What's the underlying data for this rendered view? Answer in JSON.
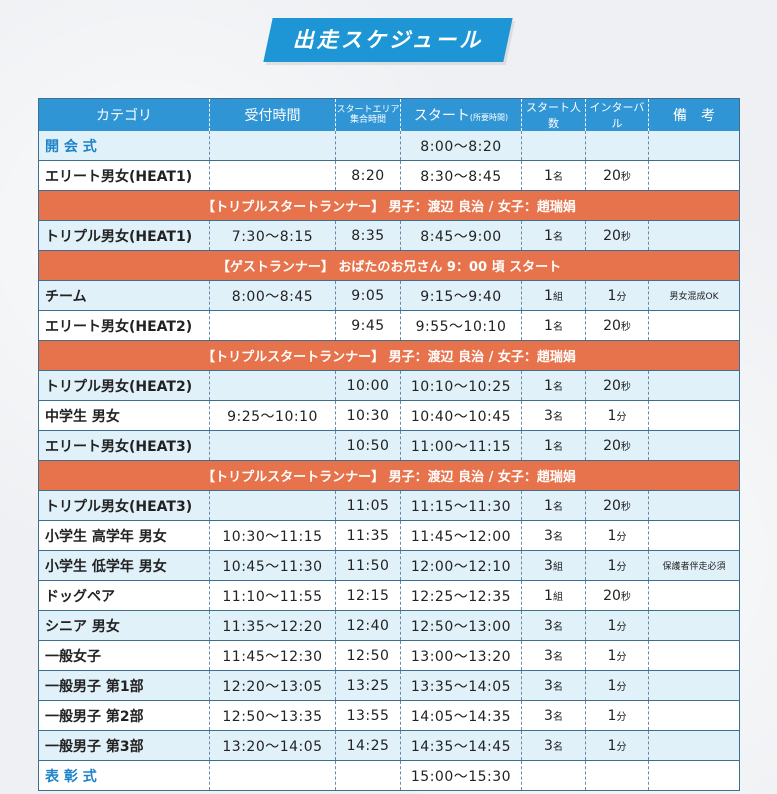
{
  "title": "出走スケジュール",
  "headers": {
    "category": "カテゴリ",
    "reception": "受付時間",
    "gather_line1": "スタートエリア",
    "gather_line2": "集合時間",
    "start": "スタート",
    "start_note": "(所要時間)",
    "count": "スタート人数",
    "interval": "インターバル",
    "remarks": "備　考"
  },
  "rows": [
    {
      "type": "row",
      "category": "開 会 式",
      "category_blue": true,
      "reception": "",
      "gather": "",
      "start": "8:00〜8:20",
      "count": "",
      "count_unit": "",
      "interval": "",
      "interval_unit": "",
      "note": ""
    },
    {
      "type": "row",
      "category": "エリート男女(HEAT1)",
      "reception": "",
      "gather": "8:20",
      "start": "8:30〜8:45",
      "count": "1",
      "count_unit": "名",
      "interval": "20",
      "interval_unit": "秒",
      "note": ""
    },
    {
      "type": "banner",
      "text": "【トリプルスタートランナー】 男子：渡辺 良治 / 女子：趙瑞娟"
    },
    {
      "type": "row",
      "category": "トリプル男女(HEAT1)",
      "reception": "7:30〜8:15",
      "gather": "8:35",
      "start": "8:45〜9:00",
      "count": "1",
      "count_unit": "名",
      "interval": "20",
      "interval_unit": "秒",
      "note": ""
    },
    {
      "type": "banner",
      "text": "【ゲストランナー】 おばたのお兄さん 9：00 頃 スタート"
    },
    {
      "type": "row",
      "category": "チーム",
      "reception": "8:00〜8:45",
      "gather": "9:05",
      "start": "9:15〜9:40",
      "count": "1",
      "count_unit": "組",
      "interval": "1",
      "interval_unit": "分",
      "note": "男女混成OK"
    },
    {
      "type": "row",
      "category": "エリート男女(HEAT2)",
      "reception": "",
      "gather": "9:45",
      "start": "9:55〜10:10",
      "count": "1",
      "count_unit": "名",
      "interval": "20",
      "interval_unit": "秒",
      "note": ""
    },
    {
      "type": "banner",
      "text": "【トリプルスタートランナー】 男子：渡辺 良治 / 女子：趙瑞娟"
    },
    {
      "type": "row",
      "category": "トリプル男女(HEAT2)",
      "reception": "",
      "gather": "10:00",
      "start": "10:10〜10:25",
      "count": "1",
      "count_unit": "名",
      "interval": "20",
      "interval_unit": "秒",
      "note": ""
    },
    {
      "type": "row",
      "category": "中学生 男女",
      "reception": "9:25〜10:10",
      "gather": "10:30",
      "start": "10:40〜10:45",
      "count": "3",
      "count_unit": "名",
      "interval": "1",
      "interval_unit": "分",
      "note": ""
    },
    {
      "type": "row",
      "category": "エリート男女(HEAT3)",
      "reception": "",
      "gather": "10:50",
      "start": "11:00〜11:15",
      "count": "1",
      "count_unit": "名",
      "interval": "20",
      "interval_unit": "秒",
      "note": ""
    },
    {
      "type": "banner",
      "text": "【トリプルスタートランナー】 男子：渡辺 良治 / 女子：趙瑞娟"
    },
    {
      "type": "row",
      "category": "トリプル男女(HEAT3)",
      "reception": "",
      "gather": "11:05",
      "start": "11:15〜11:30",
      "count": "1",
      "count_unit": "名",
      "interval": "20",
      "interval_unit": "秒",
      "note": ""
    },
    {
      "type": "row",
      "category": "小学生 高学年 男女",
      "reception": "10:30〜11:15",
      "gather": "11:35",
      "start": "11:45〜12:00",
      "count": "3",
      "count_unit": "名",
      "interval": "1",
      "interval_unit": "分",
      "note": ""
    },
    {
      "type": "row",
      "category": "小学生 低学年 男女",
      "reception": "10:45〜11:30",
      "gather": "11:50",
      "start": "12:00〜12:10",
      "count": "3",
      "count_unit": "組",
      "interval": "1",
      "interval_unit": "分",
      "note": "保護者伴走必須"
    },
    {
      "type": "row",
      "category": "ドッグペア",
      "reception": "11:10〜11:55",
      "gather": "12:15",
      "start": "12:25〜12:35",
      "count": "1",
      "count_unit": "組",
      "interval": "20",
      "interval_unit": "秒",
      "note": ""
    },
    {
      "type": "row",
      "category": "シニア 男女",
      "reception": "11:35〜12:20",
      "gather": "12:40",
      "start": "12:50〜13:00",
      "count": "3",
      "count_unit": "名",
      "interval": "1",
      "interval_unit": "分",
      "note": ""
    },
    {
      "type": "row",
      "category": "一般女子",
      "reception": "11:45〜12:30",
      "gather": "12:50",
      "start": "13:00〜13:20",
      "count": "3",
      "count_unit": "名",
      "interval": "1",
      "interval_unit": "分",
      "note": ""
    },
    {
      "type": "row",
      "category": "一般男子 第1部",
      "reception": "12:20〜13:05",
      "gather": "13:25",
      "start": "13:35〜14:05",
      "count": "3",
      "count_unit": "名",
      "interval": "1",
      "interval_unit": "分",
      "note": ""
    },
    {
      "type": "row",
      "category": "一般男子 第2部",
      "reception": "12:50〜13:35",
      "gather": "13:55",
      "start": "14:05〜14:35",
      "count": "3",
      "count_unit": "名",
      "interval": "1",
      "interval_unit": "分",
      "note": ""
    },
    {
      "type": "row",
      "category": "一般男子 第3部",
      "reception": "13:20〜14:05",
      "gather": "14:25",
      "start": "14:35〜14:45",
      "count": "3",
      "count_unit": "名",
      "interval": "1",
      "interval_unit": "分",
      "note": ""
    },
    {
      "type": "row",
      "category": "表 彰 式",
      "category_blue": true,
      "reception": "",
      "gather": "",
      "start": "15:00〜15:30",
      "count": "",
      "count_unit": "",
      "interval": "",
      "interval_unit": "",
      "note": ""
    }
  ]
}
